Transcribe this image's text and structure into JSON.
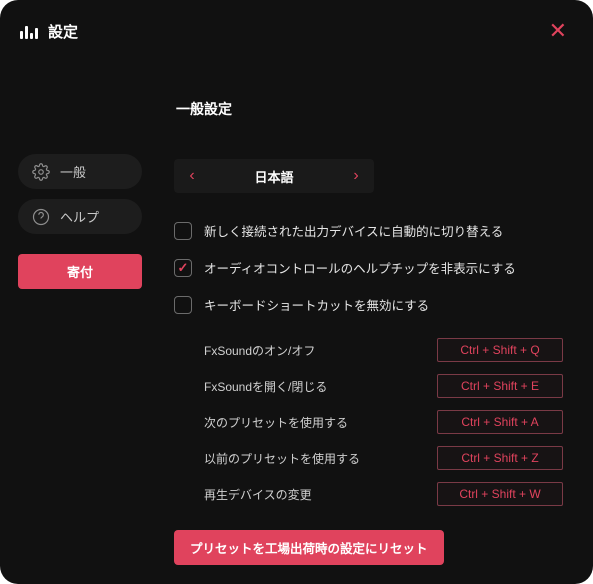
{
  "window": {
    "title": "設定"
  },
  "sidebar": {
    "items": [
      {
        "label": "一般"
      },
      {
        "label": "ヘルプ"
      }
    ],
    "donate": "寄付"
  },
  "main": {
    "heading": "一般設定",
    "language": {
      "value": "日本語"
    },
    "checks": [
      {
        "label": "新しく接続された出力デバイスに自動的に切り替える",
        "checked": false
      },
      {
        "label": "オーディオコントロールのヘルプチップを非表示にする",
        "checked": true
      },
      {
        "label": "キーボードショートカットを無効にする",
        "checked": false
      }
    ],
    "shortcuts": [
      {
        "label": "FxSoundのオン/オフ",
        "keys": "Ctrl + Shift + Q"
      },
      {
        "label": "FxSoundを開く/閉じる",
        "keys": "Ctrl + Shift + E"
      },
      {
        "label": "次のプリセットを使用する",
        "keys": "Ctrl + Shift + A"
      },
      {
        "label": "以前のプリセットを使用する",
        "keys": "Ctrl + Shift + Z"
      },
      {
        "label": "再生デバイスの変更",
        "keys": "Ctrl + Shift + W"
      }
    ],
    "reset": "プリセットを工場出荷時の設定にリセット"
  }
}
